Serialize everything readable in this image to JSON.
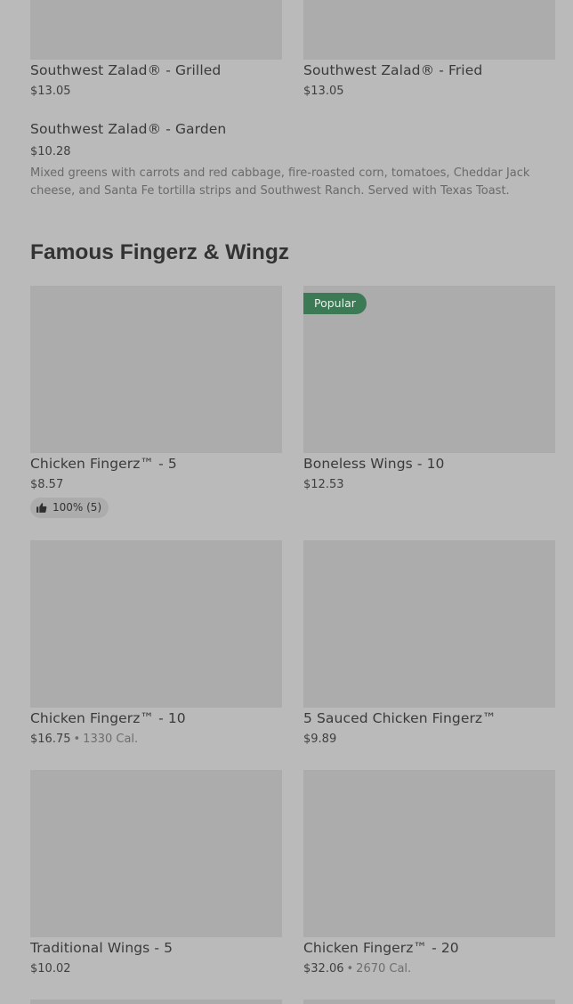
{
  "top_items": [
    {
      "name": "Southwest Zalad® - Grilled",
      "price": "$13.05"
    },
    {
      "name": "Southwest Zalad® - Fried",
      "price": "$13.05"
    }
  ],
  "garden_item": {
    "name": "Southwest Zalad® - Garden",
    "price": "$10.28",
    "description": "Mixed greens with carrots and red cabbage, fire-roasted corn, tomatoes, Cheddar Jack cheese, and Santa Fe tortilla strips and Southwest Ranch. Served with Texas Toast."
  },
  "section": {
    "title": "Famous Fingerz & Wingz"
  },
  "items": [
    {
      "name": "Chicken Fingerz™ - 5",
      "price": "$8.57",
      "rating": "100% (5)"
    },
    {
      "name": "Boneless Wings - 10",
      "price": "$12.53",
      "badge": "Popular"
    },
    {
      "name": "Chicken Fingerz™ - 10",
      "price": "$16.75",
      "separator": "•",
      "calories": "1330 Cal."
    },
    {
      "name": "5 Sauced Chicken Fingerz™",
      "price": "$9.89"
    },
    {
      "name": "Traditional Wings - 5",
      "price": "$10.02"
    },
    {
      "name": "Chicken Fingerz™ - 20",
      "price": "$32.06",
      "separator": "•",
      "calories": "2670 Cal."
    }
  ],
  "icons": {
    "rating_icon": "thumbs-up-icon"
  },
  "colors": {
    "background": "#bababa",
    "image_placeholder": "#acacac",
    "badge_background": "#3c7a56"
  }
}
